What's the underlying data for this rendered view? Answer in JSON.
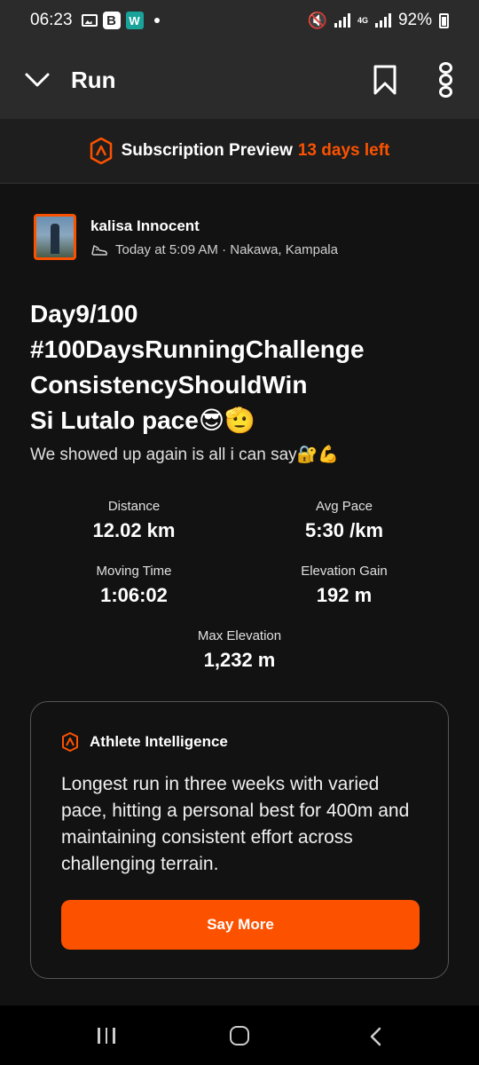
{
  "status_bar": {
    "time": "06:23",
    "battery": "92%",
    "network": "4G"
  },
  "header": {
    "title": "Run"
  },
  "subscription": {
    "label": "Subscription Preview",
    "days_left": "13 days left"
  },
  "athlete": {
    "name": "kalisa Innocent",
    "meta": "Today at 5:09 AM · Nakawa, Kampala"
  },
  "post": {
    "title": "Day9/100\n#100DaysRunningChallenge\nConsistencyShouldWin\nSi Lutalo pace😎🫡",
    "description": "We showed up again is all i can say🔐💪"
  },
  "stats": {
    "distance": {
      "label": "Distance",
      "value": "12.02 km"
    },
    "avg_pace": {
      "label": "Avg Pace",
      "value": "5:30 /km"
    },
    "moving_time": {
      "label": "Moving Time",
      "value": "1:06:02"
    },
    "elevation_gain": {
      "label": "Elevation Gain",
      "value": "192 m"
    },
    "max_elevation": {
      "label": "Max Elevation",
      "value": "1,232 m"
    }
  },
  "athlete_intelligence": {
    "title": "Athlete Intelligence",
    "text": "Longest run in three weeks with varied pace, hitting a personal best for 400m and maintaining consistent effort across challenging terrain.",
    "button_label": "Say More"
  },
  "colors": {
    "accent": "#fc5200",
    "background": "#121212",
    "bar": "#2b2b2b"
  }
}
